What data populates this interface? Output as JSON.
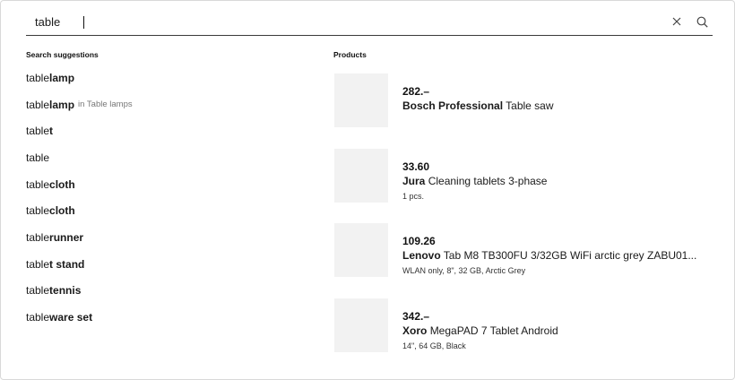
{
  "search": {
    "value": "table",
    "clear_icon": "close-icon",
    "search_icon": "search-icon"
  },
  "suggestions": {
    "heading": "Search suggestions",
    "items": [
      {
        "prefix": "table",
        "suffix": " lamp",
        "category": ""
      },
      {
        "prefix": "table",
        "suffix": " lamp",
        "category": "in Table lamps"
      },
      {
        "prefix": "table",
        "suffix": "t",
        "category": ""
      },
      {
        "prefix": "table",
        "suffix": "",
        "category": ""
      },
      {
        "prefix": "table",
        "suffix": " cloth",
        "category": ""
      },
      {
        "prefix": "table",
        "suffix": "cloth",
        "category": ""
      },
      {
        "prefix": "table",
        "suffix": " runner",
        "category": ""
      },
      {
        "prefix": "table",
        "suffix": "t stand",
        "category": ""
      },
      {
        "prefix": "table",
        "suffix": " tennis",
        "category": ""
      },
      {
        "prefix": "table",
        "suffix": "ware set",
        "category": ""
      }
    ]
  },
  "products": {
    "heading": "Products",
    "items": [
      {
        "price": "282.–",
        "brand": "Bosch Professional",
        "name": "Table saw",
        "details": ""
      },
      {
        "price": "33.60",
        "brand": "Jura",
        "name": "Cleaning tablets 3-phase",
        "details": "1 pcs."
      },
      {
        "price": "109.26",
        "brand": "Lenovo",
        "name": "Tab M8 TB300FU 3/32GB WiFi arctic grey ZABU01...",
        "details": "WLAN only, 8\", 32 GB, Arctic Grey"
      },
      {
        "price": "342.–",
        "brand": "Xoro",
        "name": "MegaPAD 7 Tablet Android",
        "details": "14\", 64 GB, Black"
      }
    ]
  }
}
